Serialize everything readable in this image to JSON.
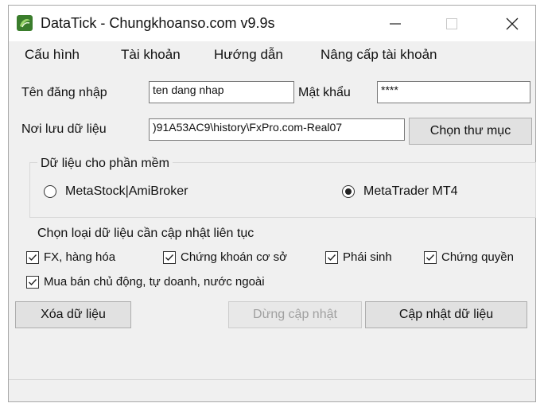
{
  "window": {
    "title": "DataTick - Chungkhoanso.com v9.9s",
    "controls": {
      "minimize": "—",
      "maximize": "☐",
      "close": "✕"
    }
  },
  "menu": [
    "Cấu hình",
    "Tài khoản",
    "Hướng dẫn",
    "Nâng cấp tài khoản"
  ],
  "login": {
    "username_label": "Tên đăng nhập",
    "username_value": "ten dang nhap",
    "password_label": "Mật khẩu",
    "password_value": "****"
  },
  "storage": {
    "label": "Nơi lưu dữ liệu",
    "path_value": ")91A53AC9\\history\\FxPro.com-Real07",
    "choose_folder_button": "Chọn thư mục"
  },
  "software_group": {
    "title": "Dữ liệu cho phần mềm",
    "options": [
      {
        "label": "MetaStock|AmiBroker",
        "selected": false
      },
      {
        "label": "MetaTrader MT4",
        "selected": true
      }
    ]
  },
  "data_types": {
    "title": "Chọn loại dữ liệu cần cập nhật liên tục",
    "options": [
      {
        "label": "FX, hàng hóa",
        "checked": true
      },
      {
        "label": "Chứng khoán cơ sở",
        "checked": true
      },
      {
        "label": "Phái sinh",
        "checked": true
      },
      {
        "label": "Chứng quyền",
        "checked": true
      },
      {
        "label": "Mua bán chủ động, tự doanh, nước ngoài",
        "checked": true
      }
    ]
  },
  "actions": {
    "delete_data": "Xóa dữ liệu",
    "stop_update": "Dừng cập nhật",
    "update_data": "Cập nhật dữ liệu"
  },
  "colors": {
    "window_bg": "#f0f0f0",
    "titlebar_bg": "#ffffff",
    "disabled_text": "#a0a0a0"
  },
  "icons": {
    "app": "datatick-app-icon",
    "check": "checkmark-icon"
  }
}
